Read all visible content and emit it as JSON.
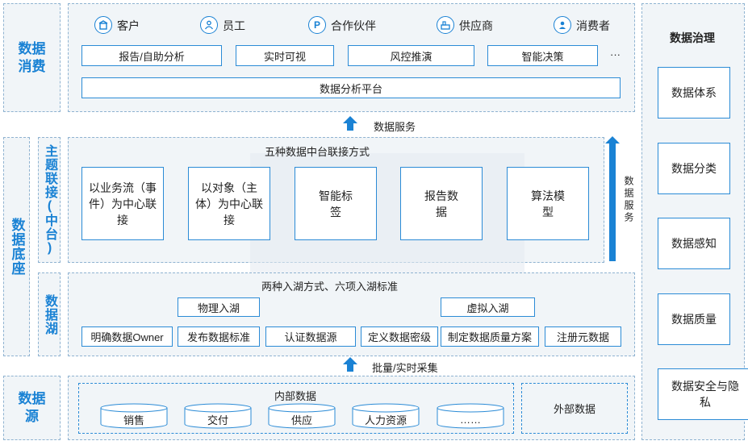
{
  "layers": {
    "consumption": "数据消费",
    "foundation": "数据底座",
    "middle_platform": "主题联接(中台)",
    "data_lake": "数据湖",
    "source": "数据源"
  },
  "consumers": [
    {
      "icon": "customer-icon",
      "label": "客户"
    },
    {
      "icon": "employee-icon",
      "label": "员工"
    },
    {
      "icon": "partner-icon",
      "label": "合作伙伴",
      "glyph": "P"
    },
    {
      "icon": "supplier-icon",
      "label": "供应商"
    },
    {
      "icon": "consumer-icon",
      "label": "消费者"
    }
  ],
  "apps": [
    "报告/自助分析",
    "实时可视",
    "风控推演",
    "智能决策"
  ],
  "apps_more": "···",
  "platform": "数据分析平台",
  "service_label": "数据服务",
  "side_service_label": "数据服务",
  "middle": {
    "title": "五种数据中台联接方式",
    "items": [
      "以业务流（事件）为中心联接",
      "以对象（主体）为中心联接",
      "智能标签",
      "报告数据",
      "算法模型"
    ]
  },
  "lake": {
    "title": "两种入湖方式、六项入湖标准",
    "modes": [
      "物理入湖",
      "虚拟入湖"
    ],
    "standards": [
      "明确数据Owner",
      "发布数据标准",
      "认证数据源",
      "定义数据密级",
      "制定数据质量方案",
      "注册元数据"
    ]
  },
  "collect_label": "批量/实时采集",
  "source": {
    "internal_title": "内部数据",
    "internal_items": [
      "销售",
      "交付",
      "供应",
      "人力资源",
      "……"
    ],
    "external_title": "外部数据"
  },
  "governance": {
    "title": "数据治理",
    "items": [
      "数据体系",
      "数据分类",
      "数据感知",
      "数据质量",
      "数据安全与隐私"
    ]
  },
  "colors": {
    "accent": "#1a82d4",
    "panel": "#f1f5f8"
  }
}
